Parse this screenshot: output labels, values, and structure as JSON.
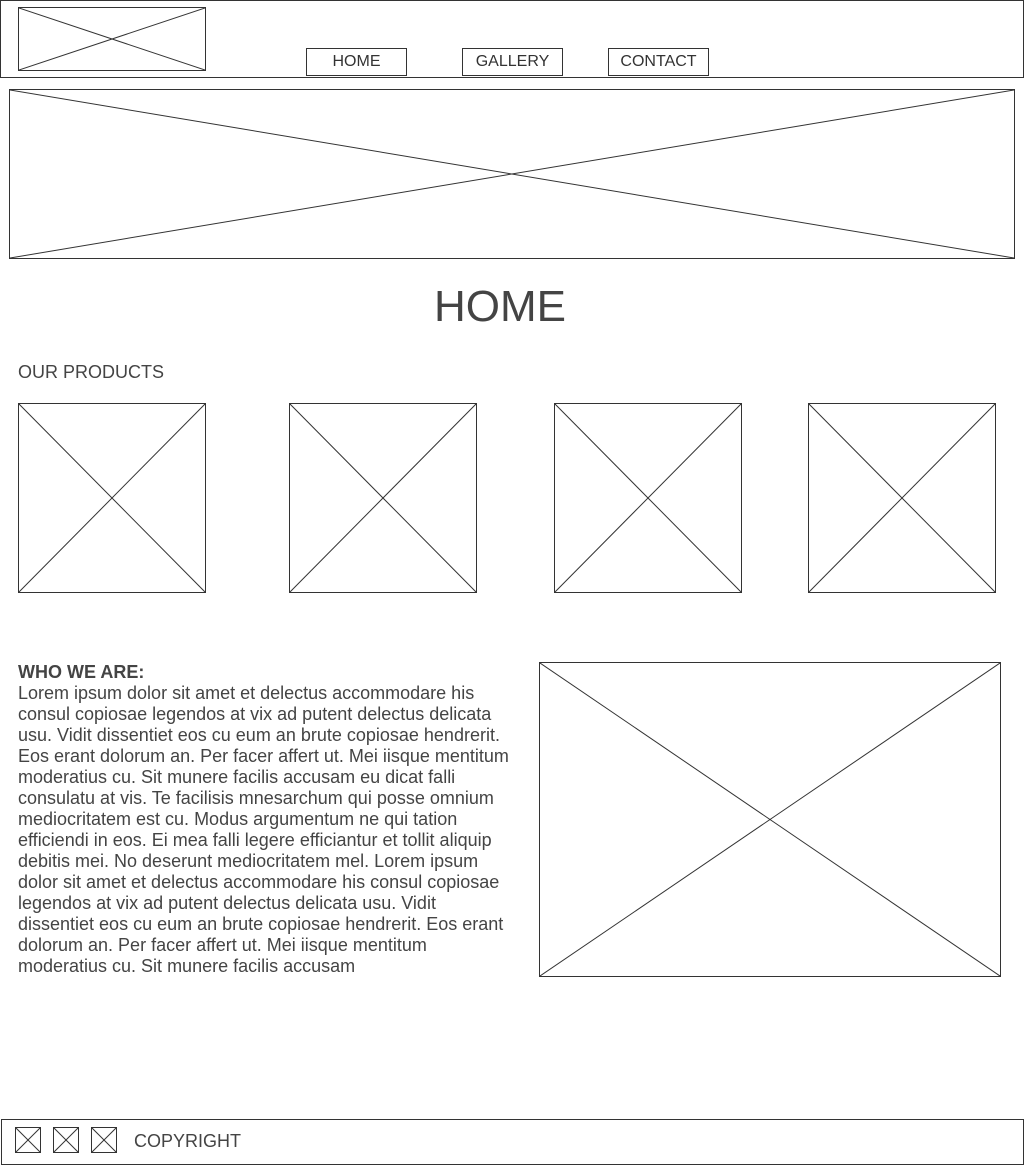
{
  "header": {
    "logo_icon": "image-placeholder-icon",
    "nav": {
      "home_label": "HOME",
      "gallery_label": "GALLERY",
      "contact_label": "CONTACT"
    }
  },
  "hero": {
    "icon": "image-placeholder-icon"
  },
  "main": {
    "page_title": "HOME",
    "products": {
      "heading": "OUR PRODUCTS",
      "item_icon": "image-placeholder-icon",
      "count_shown": 4
    },
    "about": {
      "heading": "WHO WE ARE:",
      "body": "Lorem ipsum dolor sit amet et delectus accommodare his consul copiosae legendos at vix ad putent delectus delicata usu. Vidit dissentiet eos cu eum an brute copiosae hendrerit. Eos erant dolorum an. Per facer affert ut. Mei iisque mentitum moderatius cu. Sit munere facilis accusam eu dicat falli consulatu at vis. Te facilisis mnesarchum qui posse omnium mediocritatem est cu. Modus argumentum ne qui tation efficiendi in eos. Ei mea falli legere efficiantur et tollit aliquip debitis mei. No deserunt mediocritatem mel. Lorem ipsum dolor sit amet et delectus accommodare his consul copiosae legendos at vix ad putent delectus delicata usu. Vidit dissentiet eos cu eum an brute copiosae hendrerit. Eos erant dolorum an. Per facer affert ut. Mei iisque mentitum moderatius cu. Sit munere facilis accusam",
      "image_icon": "image-placeholder-icon"
    }
  },
  "footer": {
    "social_icons": [
      "social-placeholder-icon",
      "social-placeholder-icon",
      "social-placeholder-icon"
    ],
    "copyright": "COPYRIGHT"
  },
  "colors": {
    "stroke": "#333333",
    "text": "#444444",
    "background": "#ffffff"
  }
}
